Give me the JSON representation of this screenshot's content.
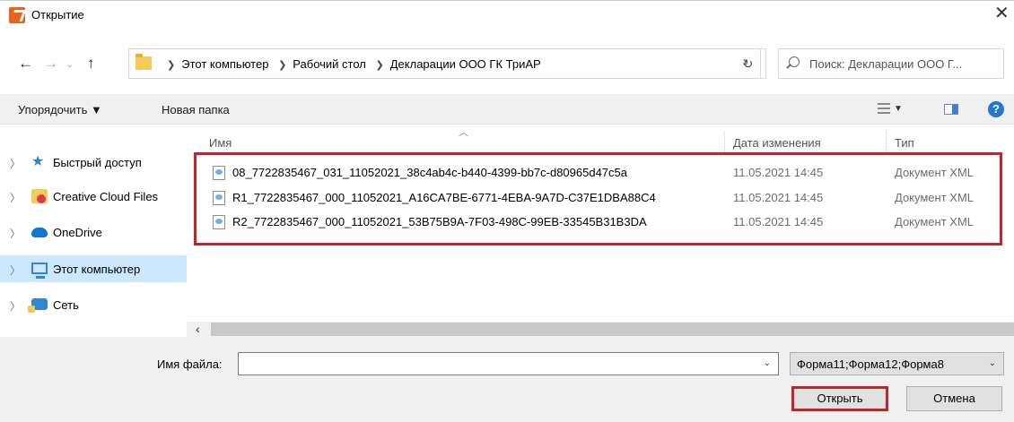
{
  "window": {
    "title": "Открытие"
  },
  "address": {
    "crumbs": [
      "Этот компьютер",
      "Рабочий стол",
      "Декларации ООО ГК ТриАР"
    ],
    "search_placeholder": "Поиск: Декларации ООО Г..."
  },
  "toolbar": {
    "organize_label": "Упорядочить ▼",
    "new_folder_label": "Новая папка"
  },
  "nav": {
    "items": [
      {
        "label": "Быстрый доступ",
        "icon": "star-icon"
      },
      {
        "label": "Creative Cloud Files",
        "icon": "creative-cloud-folder-icon"
      },
      {
        "label": "OneDrive",
        "icon": "cloud-icon"
      },
      {
        "label": "Этот компьютер",
        "icon": "computer-icon",
        "selected": true
      },
      {
        "label": "Сеть",
        "icon": "network-icon"
      }
    ]
  },
  "list": {
    "columns": {
      "name": "Имя",
      "date": "Дата изменения",
      "type": "Тип"
    },
    "files": [
      {
        "name": "08_7722835467_031_11052021_38c4ab4c-b440-4399-bb7c-d80965d47c5a",
        "date": "11.05.2021 14:45",
        "type": "Документ XML"
      },
      {
        "name": "R1_7722835467_000_11052021_A16CA7BE-6771-4EBA-9A7D-C37E1DBA88C4",
        "date": "11.05.2021 14:45",
        "type": "Документ XML"
      },
      {
        "name": "R2_7722835467_000_11052021_53B75B9A-7F03-498C-99EB-33545B31B3DA",
        "date": "11.05.2021 14:45",
        "type": "Документ XML"
      }
    ]
  },
  "bottom": {
    "filename_label": "Имя файла:",
    "filename_value": "",
    "filter_value": "Форма11;Форма12;Форма8",
    "open_label": "Открыть",
    "cancel_label": "Отмена"
  },
  "colors": {
    "highlight": "#c4232b",
    "selection": "#cce8ff"
  }
}
